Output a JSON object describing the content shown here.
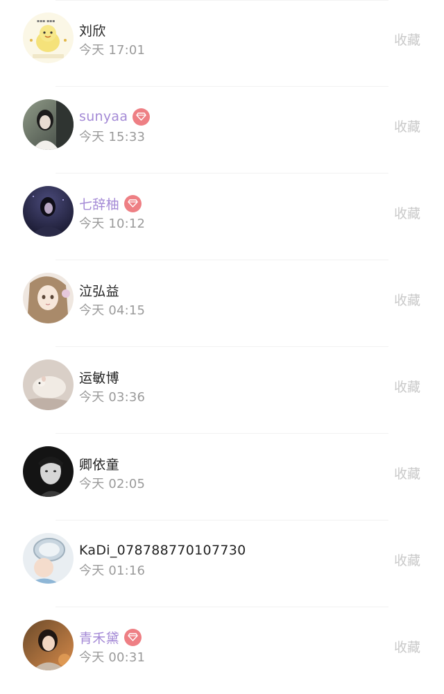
{
  "colors": {
    "vip_name": "#a48ad6",
    "vip_badge": "#ee7f84",
    "name": "#222222",
    "time": "#9a9a9a",
    "action": "#c9c9c9"
  },
  "items": [
    {
      "name": "刘欣",
      "time": "今天 17:01",
      "action": "收藏",
      "vip": false,
      "avatar": "cartoon-duck-avatar"
    },
    {
      "name": "sunyaa",
      "time": "今天 15:33",
      "action": "收藏",
      "vip": true,
      "badge_icon": "diamond-icon",
      "avatar": "girl-photo-avatar"
    },
    {
      "name": "七辞柚",
      "time": "今天 10:12",
      "action": "收藏",
      "vip": true,
      "badge_icon": "diamond-icon",
      "avatar": "night-photo-avatar"
    },
    {
      "name": "泣弘益",
      "time": "今天 04:15",
      "action": "收藏",
      "vip": false,
      "avatar": "anime-girl-avatar"
    },
    {
      "name": "运敏博",
      "time": "今天 03:36",
      "action": "收藏",
      "vip": false,
      "avatar": "hamster-avatar"
    },
    {
      "name": "卿依童",
      "time": "今天 02:05",
      "action": "收藏",
      "vip": false,
      "avatar": "man-portrait-avatar"
    },
    {
      "name": "KaDi_078788770107730",
      "time": "今天 01:16",
      "action": "收藏",
      "vip": false,
      "avatar": "child-photo-avatar"
    },
    {
      "name": "青禾黛",
      "time": "今天 00:31",
      "action": "收藏",
      "vip": true,
      "badge_icon": "diamond-icon",
      "avatar": "woman-portrait-avatar"
    }
  ]
}
